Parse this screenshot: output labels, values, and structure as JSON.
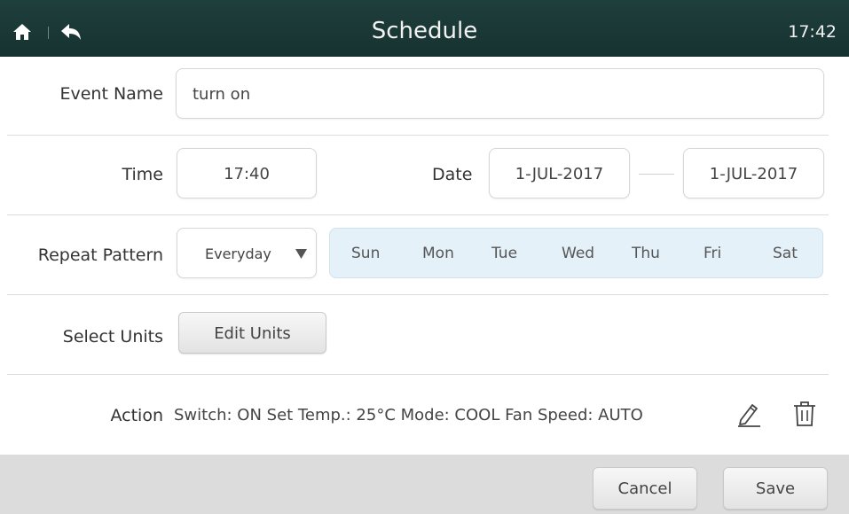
{
  "header": {
    "title": "Schedule",
    "time": "17:42",
    "bg_color": "#1a3735"
  },
  "form": {
    "event_name": {
      "label": "Event Name",
      "value": "turn on"
    },
    "time": {
      "label": "Time",
      "value": "17:40"
    },
    "date": {
      "label": "Date",
      "start": "1-JUL-2017",
      "end": "1-JUL-2017"
    },
    "repeat": {
      "label": "Repeat Pattern",
      "selected": "Everyday",
      "days": [
        "Sun",
        "Mon",
        "Tue",
        "Wed",
        "Thu",
        "Fri",
        "Sat"
      ],
      "days_bg_color": "#e5f1f8"
    },
    "units": {
      "label": "Select Units",
      "button": "Edit Units"
    },
    "action": {
      "label": "Action",
      "summary": "Switch: ON  Set Temp.: 25°C  Mode: COOL  Fan Speed: AUTO"
    }
  },
  "footer": {
    "cancel": "Cancel",
    "save": "Save"
  },
  "icons": {
    "home": "home-icon",
    "back": "back-arrow-icon",
    "dropdown": "triangle-down-icon",
    "edit": "pencil-icon",
    "delete": "trash-icon"
  }
}
